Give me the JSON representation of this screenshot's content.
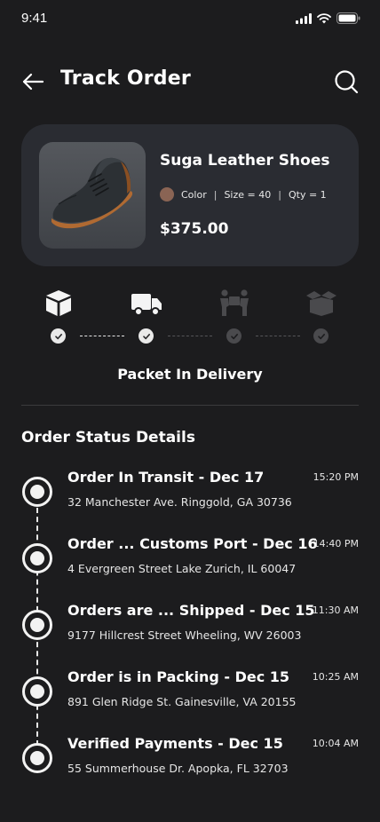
{
  "status_bar": {
    "time": "9:41"
  },
  "header": {
    "title": "Track Order",
    "back_icon": "arrow-left-icon",
    "search_icon": "search-icon"
  },
  "product": {
    "name": "Suga Leather Shoes",
    "color_label": "Color",
    "color_swatch": "#8a6454",
    "size": "Size = 40",
    "qty": "Qty = 1",
    "price": "$375.00",
    "separator": "|"
  },
  "progress": {
    "steps": [
      {
        "icon": "package-icon",
        "done": true
      },
      {
        "icon": "truck-icon",
        "done": true
      },
      {
        "icon": "handover-icon",
        "done": false
      },
      {
        "icon": "open-box-icon",
        "done": false
      }
    ],
    "current_label": "Packet In Delivery"
  },
  "order_status": {
    "title": "Order Status Details",
    "events": [
      {
        "title": "Order In Transit - Dec 17",
        "address": "32 Manchester Ave. Ringgold, GA 30736",
        "time": "15:20 PM"
      },
      {
        "title": "Order ... Customs Port - Dec 16",
        "address": "4 Evergreen Street Lake Zurich, IL 60047",
        "time": "14:40 PM"
      },
      {
        "title": "Orders are ... Shipped - Dec 15",
        "address": "9177 Hillcrest Street Wheeling, WV 26003",
        "time": "11:30 AM"
      },
      {
        "title": "Order is in Packing - Dec 15",
        "address": "891 Glen Ridge St. Gainesville, VA 20155",
        "time": "10:25 AM"
      },
      {
        "title": "Verified Payments - Dec 15",
        "address": "55 Summerhouse Dr. Apopka, FL 32703",
        "time": "10:04 AM"
      }
    ]
  }
}
